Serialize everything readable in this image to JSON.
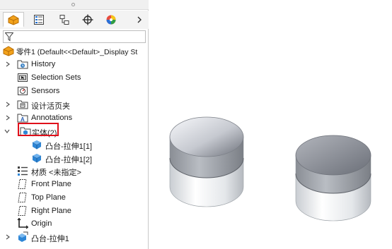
{
  "tabs": [
    {
      "name": "feature-manager",
      "icon": "feature-manager-icon",
      "active": true
    },
    {
      "name": "property-manager",
      "icon": "property-manager-icon",
      "active": false
    },
    {
      "name": "configuration-manager",
      "icon": "configuration-manager-icon",
      "active": false
    },
    {
      "name": "dimxpert-manager",
      "icon": "dimxpert-icon",
      "active": false
    },
    {
      "name": "display-manager",
      "icon": "display-manager-icon",
      "active": false
    }
  ],
  "tree": {
    "root": "零件1  (Default<<Default>_Display St",
    "items": [
      {
        "label": "History",
        "icon": "history-folder-icon",
        "caret": true
      },
      {
        "label": "Selection Sets",
        "icon": "selection-sets-icon",
        "caret": false
      },
      {
        "label": "Sensors",
        "icon": "sensors-icon",
        "caret": false
      },
      {
        "label": "设计活页夹",
        "icon": "design-binder-icon",
        "caret": true
      },
      {
        "label": "Annotations",
        "icon": "annotations-icon",
        "caret": true
      },
      {
        "label": "实体(2)",
        "icon": "solid-bodies-folder-icon",
        "caret": "expanded"
      },
      {
        "label": "凸台-拉伸1[1]",
        "icon": "solid-body-icon",
        "caret": false
      },
      {
        "label": "凸台-拉伸1[2]",
        "icon": "solid-body-icon",
        "caret": false
      },
      {
        "label": "材质 <未指定>",
        "icon": "material-icon",
        "caret": false
      },
      {
        "label": "Front Plane",
        "icon": "plane-icon",
        "caret": false
      },
      {
        "label": "Top Plane",
        "icon": "plane-icon",
        "caret": false
      },
      {
        "label": "Right Plane",
        "icon": "plane-icon",
        "caret": false
      },
      {
        "label": "Origin",
        "icon": "origin-icon",
        "caret": false
      },
      {
        "label": "凸台-拉伸1",
        "icon": "boss-extrude-icon",
        "caret": true
      }
    ]
  },
  "colors": {
    "highlight_box": "#e0101a",
    "cylinder_top_light": "#eceff4",
    "cylinder_top_dark": "#8c9097",
    "cylinder_side": "#e9ecef"
  }
}
